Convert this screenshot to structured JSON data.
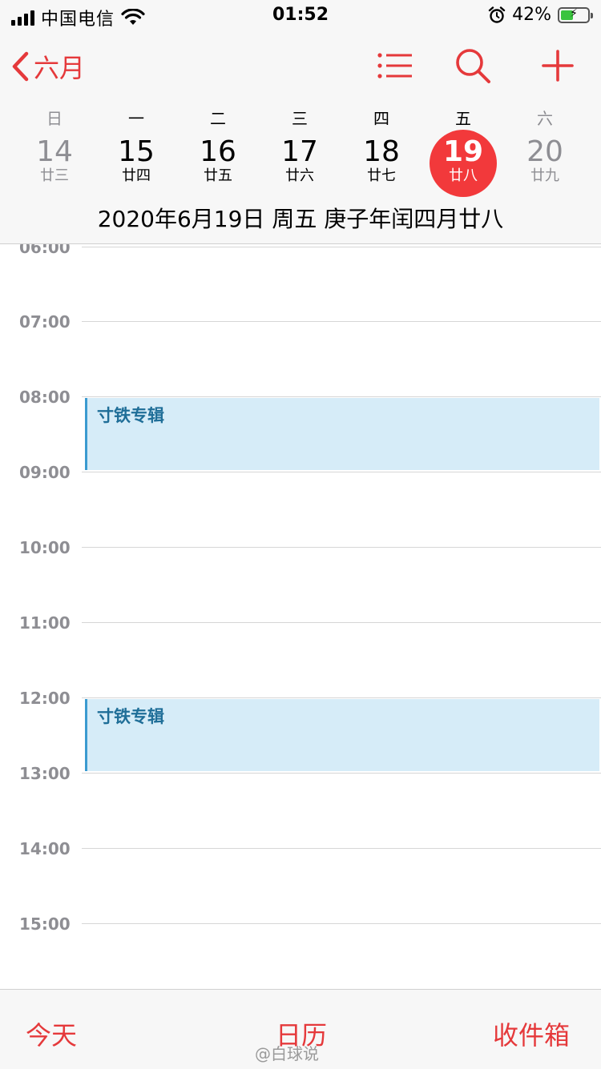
{
  "status_bar": {
    "carrier": "中国电信",
    "time": "01:52",
    "battery_percent": "42%",
    "icons": [
      "signal-icon",
      "wifi-icon",
      "alarm-icon",
      "battery-charging-icon"
    ]
  },
  "nav": {
    "back_label": "六月",
    "actions": [
      "list-icon",
      "search-icon",
      "add-icon"
    ]
  },
  "week": {
    "weekdays": [
      "日",
      "一",
      "二",
      "三",
      "四",
      "五",
      "六"
    ],
    "days": [
      {
        "num": "14",
        "lunar": "廿三"
      },
      {
        "num": "15",
        "lunar": "廿四"
      },
      {
        "num": "16",
        "lunar": "廿五"
      },
      {
        "num": "17",
        "lunar": "廿六"
      },
      {
        "num": "18",
        "lunar": "廿七"
      },
      {
        "num": "19",
        "lunar": "廿八"
      },
      {
        "num": "20",
        "lunar": "廿九"
      }
    ],
    "selected_day": "19"
  },
  "full_date": "2020年6月19日 周五   庚子年闰四月廿八",
  "timeline": {
    "hours": [
      "06:00",
      "07:00",
      "08:00",
      "09:00",
      "10:00",
      "11:00",
      "12:00",
      "13:00",
      "14:00",
      "15:00"
    ],
    "events": [
      {
        "title": "寸铁专辑",
        "start": "08:00",
        "end": "09:00"
      },
      {
        "title": "寸铁专辑",
        "start": "12:00",
        "end": "13:00"
      }
    ]
  },
  "tabs": {
    "today": "今天",
    "calendars": "日历",
    "inbox": "收件箱"
  },
  "watermark": "@白球说",
  "colors": {
    "accent": "#e5393b",
    "event_bg": "#d6ecf8",
    "event_bar": "#3b9bd0",
    "event_text": "#1f6e98"
  }
}
